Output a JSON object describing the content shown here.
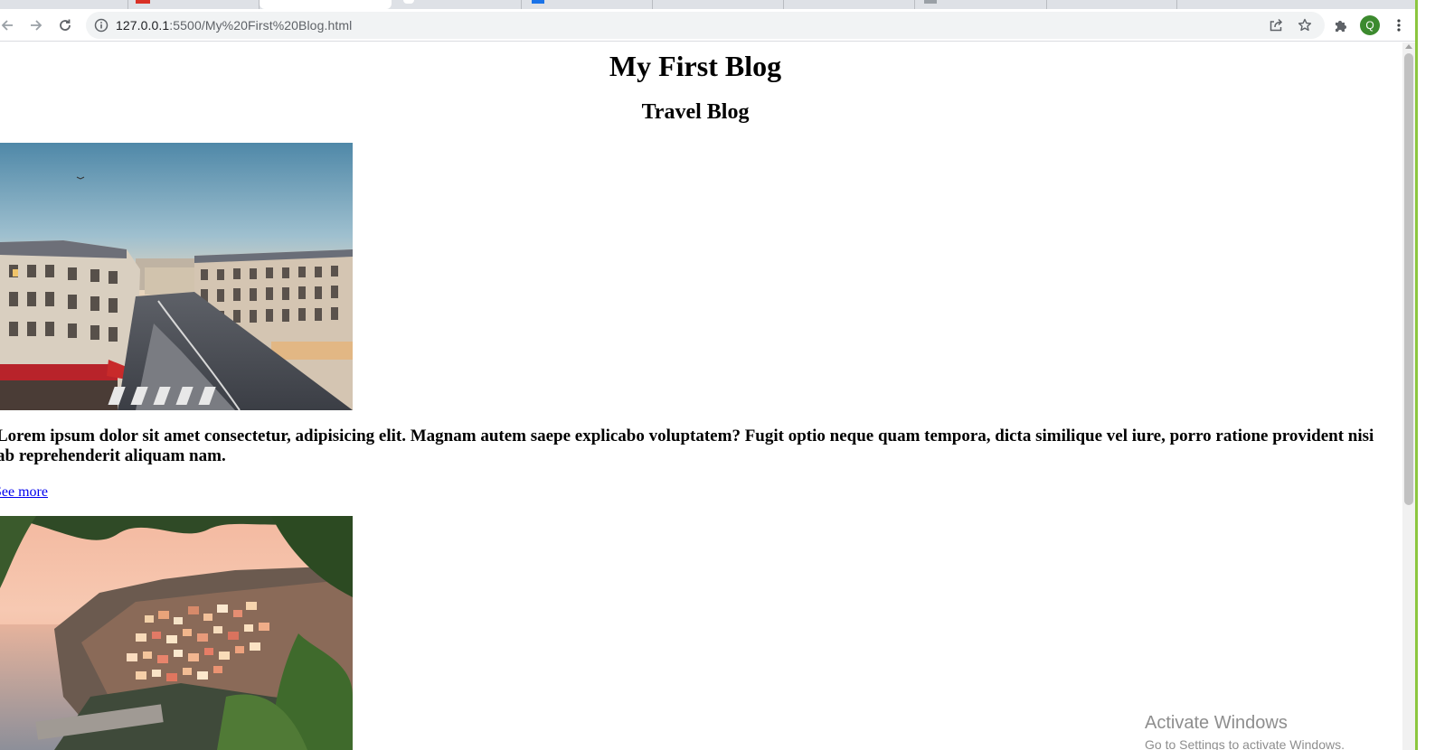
{
  "browser": {
    "url_host": "127.0.0.1",
    "url_rest": ":5500/My%20First%20Blog.html",
    "avatar_letter": "Q",
    "avatar_color": "#3c8a2e"
  },
  "page": {
    "title": "My First Blog",
    "subtitle": "Travel Blog",
    "post_text": "Lorem ipsum dolor sit amet consectetur, adipisicing elit. Magnam autem saepe explicabo voluptatem? Fugit optio neque quam tempora, dicta similique vel iure, porro ratione provident nisi ab reprehenderit aliquam nam.",
    "see_more": "See more",
    "link_color": "#0000ee"
  },
  "overlay": {
    "activate_title": "Activate Windows",
    "activate_sub": "Go to Settings to activate Windows."
  },
  "icons": {
    "back": "arrow-left-icon",
    "forward": "arrow-right-icon",
    "reload": "reload-icon",
    "site_info": "info-icon",
    "share": "share-icon",
    "bookmark": "star-icon",
    "extensions": "puzzle-icon",
    "menu": "kebab-menu-icon"
  }
}
